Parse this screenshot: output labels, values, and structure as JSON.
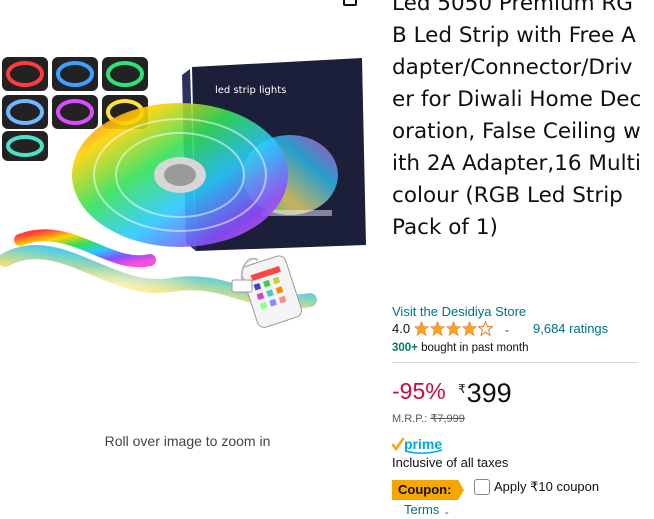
{
  "product": {
    "title": "Led 5050 Premium RGB Led Strip with Free Adapter/Connector/Driver for Diwali Home Decoration, False Ceiling with 2A Adapter,16 Multicolour (RGB Led Strip Pack of 1)",
    "box_label": "led strip lights"
  },
  "gallery": {
    "zoom_hint": "Roll over image to zoom in",
    "icons": [
      "share-icon"
    ]
  },
  "store": {
    "link_text": "Visit the Desidiya Store"
  },
  "rating": {
    "value": "4.0",
    "stars": 4,
    "count_text": "9,684 ratings",
    "star_color": "#FFA41C"
  },
  "bought": {
    "highlight": "300+",
    "text": "bought in past month"
  },
  "pricing": {
    "discount": "-95%",
    "currency": "₹",
    "price": "399",
    "mrp_label": "M.R.P.:",
    "mrp_value": "₹7,999",
    "discount_color": "#CC0C39"
  },
  "prime": {
    "label": "prime",
    "brand_color": "#00A8E1"
  },
  "taxes_text": "Inclusive of all taxes",
  "coupon": {
    "badge": "Coupon:",
    "apply_text": "Apply ₹10 coupon",
    "terms": "Terms",
    "badge_color": "#F7A600"
  }
}
